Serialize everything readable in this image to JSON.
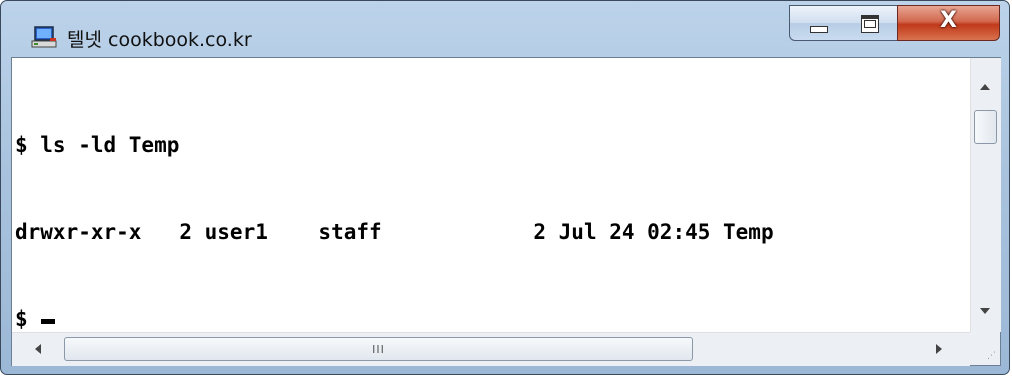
{
  "window": {
    "title": "텔넷 cookbook.co.kr",
    "icon": "telnet-computer-icon",
    "controls": {
      "minimize": "minimize-icon",
      "maximize": "maximize-icon",
      "close": "X"
    }
  },
  "terminal": {
    "lines": [
      "$ ls -ld Temp",
      "drwxr-xr-x   2 user1    staff            2 Jul 24 02:45 Temp",
      "$ "
    ]
  },
  "scrollbars": {
    "horizontal_grip": "III"
  },
  "colors": {
    "titlebar": "#a9c3de",
    "close_button": "#c0391a",
    "terminal_bg": "#ffffff",
    "terminal_text": "#000000"
  }
}
